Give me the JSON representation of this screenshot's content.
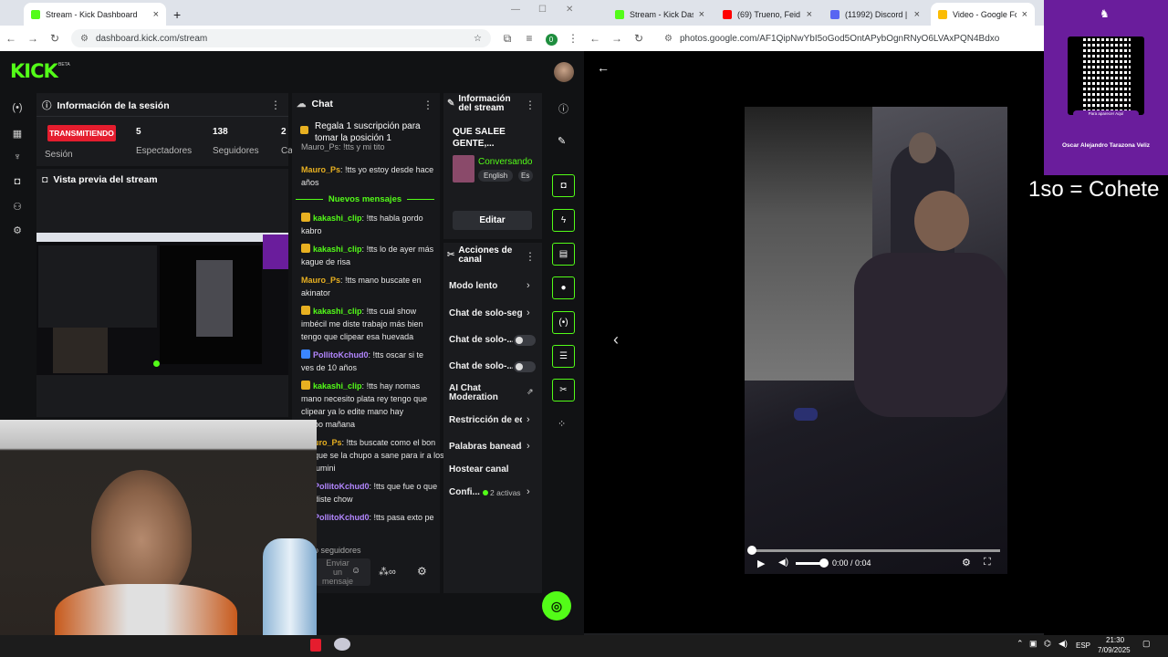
{
  "left_browser": {
    "tab_title": "Stream - Kick Dashboard",
    "url": "dashboard.kick.com/stream",
    "profile_initial": "0"
  },
  "right_browser": {
    "tabs": [
      {
        "title": "Stream - Kick Dash",
        "color": "#53fc18"
      },
      {
        "title": "(69) Trueno, Feid",
        "color": "#ff0000"
      },
      {
        "title": "(11992) Discord | A",
        "color": "#5865f2"
      },
      {
        "title": "Video - Google Fot",
        "color": "#fbbc04"
      }
    ],
    "url": "photos.google.com/AF1QipNwYbI5oGod5OntAPybOgnRNyO6LVAxPQN4Bdxo"
  },
  "kick": {
    "logo": "KICK",
    "logo_beta": "BETA",
    "session_panel": {
      "title": "Información de la sesión",
      "live_badge": "TRANSMITIENDO",
      "session_label": "Sesión",
      "viewers_value": "5",
      "viewers_label": "Espectadores",
      "followers_value": "138",
      "followers_label": "Seguidores",
      "extra_value": "2",
      "extra_label": "Ca"
    },
    "preview_panel": {
      "title": "Vista previa del stream"
    },
    "chat": {
      "title": "Chat",
      "pinned": "Regala 1 suscripción para tomar la posición 1",
      "clipped_top": "Mauro_Ps: !tts y mi tito",
      "new_messages": "Nuevos mensajes",
      "messages": [
        {
          "user": "Mauro_Ps",
          "text": "!tts yo estoy desde hace años",
          "color": "#e8b021",
          "badge": ""
        },
        {
          "user": "kakashi_clip",
          "text": "!tts habla gordo kabro",
          "color": "#53fc18",
          "badge": "crown"
        },
        {
          "user": "kakashi_clip",
          "text": "!tts lo de ayer más kague de risa",
          "color": "#53fc18",
          "badge": "crown"
        },
        {
          "user": "Mauro_Ps",
          "text": "!tts mano buscate en akinator",
          "color": "#e8b021",
          "badge": ""
        },
        {
          "user": "kakashi_clip",
          "text": "!tts cual show imbécil me diste trabajo más bien tengo que clipear esa huevada",
          "color": "#53fc18",
          "badge": "crown"
        },
        {
          "user": "PollitoKchud0",
          "text": "!tts oscar si te ves de 10 años",
          "color": "#b387ff",
          "badge": "blue"
        },
        {
          "user": "kakashi_clip",
          "text": "!tts hay nomas mano necesito plata rey tengo que clipear ya lo edite mano hay",
          "color": "#53fc18",
          "badge": "crown"
        },
        {
          "user": "",
          "text": "bo mañana",
          "color": "#53fc18",
          "badge": ""
        },
        {
          "user": "uro_Ps",
          "text": "!tts buscate como el bon que se la chupo a sane para ir a los lumini",
          "color": "#e8b021",
          "badge": ""
        },
        {
          "user": "PollitoKchud0",
          "text": "!tts que fue o que diste chow",
          "color": "#b387ff",
          "badge": ""
        },
        {
          "user": "PollitoKchud0",
          "text": "!tts pasa exto pe",
          "color": "#b387ff",
          "badge": ""
        }
      ],
      "followers_only_hint": "o seguidores",
      "input_placeholder": "Enviar un mensaje"
    },
    "stream_info": {
      "title": "Información del stream",
      "stream_title": "QUE SALEE GENTE,...",
      "category": "Conversando",
      "tags": [
        "English",
        "Es"
      ],
      "edit_label": "Editar"
    },
    "channel_actions": {
      "title": "Acciones de canal",
      "rows": [
        {
          "label": "Modo lento",
          "kind": "chevron"
        },
        {
          "label": "Chat de solo-segu",
          "kind": "chevron"
        },
        {
          "label": "Chat de solo-...",
          "kind": "toggle"
        },
        {
          "label": "Chat de solo-...",
          "kind": "toggle"
        },
        {
          "label": "AI Chat Moderation",
          "kind": "external"
        },
        {
          "label": "Restricción de ed",
          "kind": "chevron"
        },
        {
          "label": "Palabras baneada",
          "kind": "chevron"
        },
        {
          "label": "Hostear canal",
          "kind": "none"
        },
        {
          "label": "Confi...",
          "kind": "chevron"
        }
      ],
      "active_count": "2 activas"
    }
  },
  "photos": {
    "time_display": "0:00 / 0:04",
    "overlay_caption": "1so = Cohete",
    "qr_caption": "Para aparecer Aquí",
    "qr_name": "Oscar Alejandro Tarazona Veliz",
    "progress_fraction": 0
  },
  "taskbar": {
    "lang": "ESP",
    "time": "21:30",
    "date": "7/09/2025"
  },
  "colors": {
    "kick_green": "#53fc18",
    "live_red": "#e51d2e",
    "qr_purple": "#6a1d9c"
  }
}
